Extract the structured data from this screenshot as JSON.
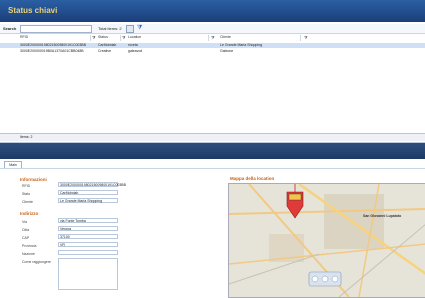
{
  "window": {
    "title": "Status chiavi"
  },
  "toolbar": {
    "search_label": "Search",
    "search_value": "",
    "total_label": "Total items: 2"
  },
  "grid": {
    "columns": [
      "RFID",
      "Status",
      "Location",
      "Cliente"
    ],
    "rows": [
      {
        "rfid": "3000E2000001980215009800191C003BB",
        "status": "CarMobdab",
        "location": "roveta",
        "cliente": "Le Grande Maria Shopping"
      },
      {
        "rfid": "3000E200000019B0A1370A01CBB048B",
        "status": "Creative",
        "location": "galeavod",
        "cliente": "Galeone"
      }
    ],
    "footer": "Items: 2"
  },
  "tabs": [
    {
      "label": "Main"
    }
  ],
  "info": {
    "section_title": "Informazioni",
    "fields": [
      {
        "label": "RFID",
        "value": "3000E2000001980215009800191C003BB"
      },
      {
        "label": "Stato",
        "value": "CarMobdab"
      },
      {
        "label": "Cliente",
        "value": "Le Grande Maria Shopping"
      }
    ]
  },
  "address": {
    "section_title": "Indirizzo",
    "fields": [
      {
        "label": "Via",
        "value": "via Fonte Tomba"
      },
      {
        "label": "Citta",
        "value": "Verona"
      },
      {
        "label": "CAP",
        "value": "37100"
      },
      {
        "label": "Provincia",
        "value": "VR"
      },
      {
        "label": "Nazione",
        "value": ""
      },
      {
        "label": "Come raggiungere",
        "value": ""
      }
    ]
  },
  "map": {
    "section_title": "Mappa della location",
    "label": "San Giovanni Lupatoto"
  }
}
